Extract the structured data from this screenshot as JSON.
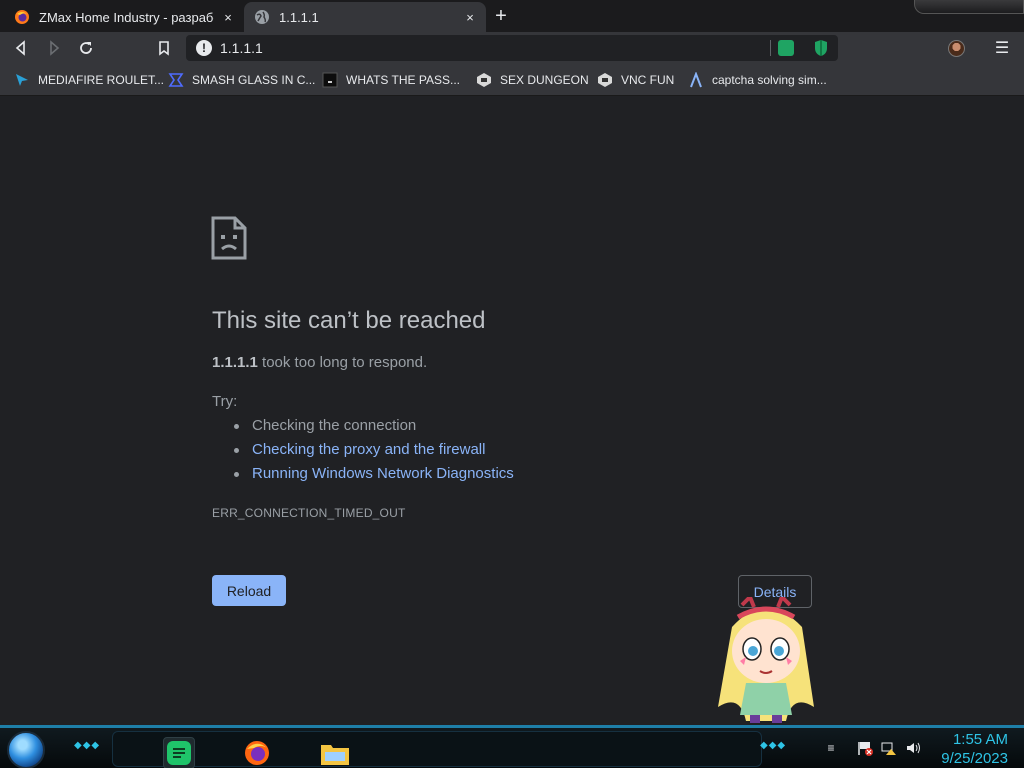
{
  "tabs": [
    {
      "title": "ZMax Home Industry - разработк",
      "close": "×",
      "icon": "firefox-icon",
      "active": false
    },
    {
      "title": "1.1.1.1",
      "close": "×",
      "icon": "globe-icon",
      "active": true
    }
  ],
  "new_tab": "+",
  "toolbar": {
    "url": "1.1.1.1",
    "info_icon": "!",
    "menu_icon": "☰"
  },
  "bookmarks": [
    {
      "label": "MEDIAFIRE ROULET...",
      "icon": "mediafire-icon"
    },
    {
      "label": "SMASH GLASS IN C...",
      "icon": "chevron-flag-icon"
    },
    {
      "label": "WHATS THE PASS...",
      "icon": "dark-box-icon"
    },
    {
      "label": "SEX DUNGEON",
      "icon": "robot-icon"
    },
    {
      "label": "VNC FUN",
      "icon": "robot-icon"
    },
    {
      "label": "captcha solving sim...",
      "icon": "lambda-icon"
    }
  ],
  "error": {
    "title": "This site can’t be reached",
    "host": "1.1.1.1",
    "desc": " took too long to respond.",
    "try_label": "Try:",
    "suggestions": [
      {
        "text": "Checking the connection",
        "link": false
      },
      {
        "text": "Checking the proxy and the firewall",
        "link": true
      },
      {
        "text": "Running Windows Network Diagnostics",
        "link": true
      }
    ],
    "code": "ERR_CONNECTION_TIMED_OUT",
    "reload_label": "Reload",
    "details_label": "Details"
  },
  "taskbar": {
    "time": "1:55 AM",
    "date": "9/25/2023"
  },
  "colors": {
    "accent": "#8ab4f8",
    "page_bg": "#202124",
    "clock": "#2ec4e6"
  }
}
